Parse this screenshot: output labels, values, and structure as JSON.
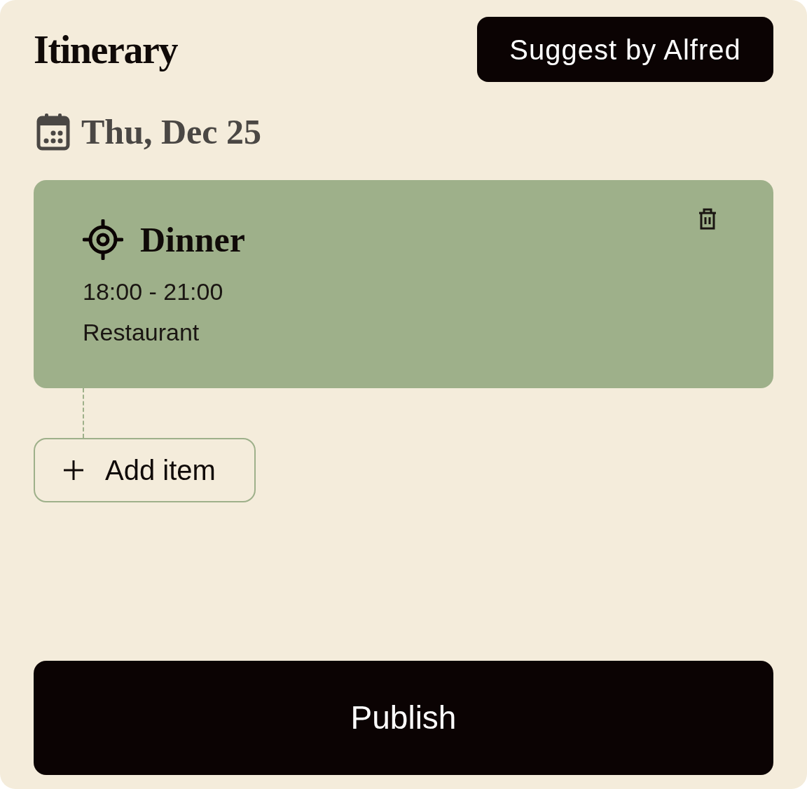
{
  "header": {
    "title": "Itinerary",
    "suggest_button": "Suggest by Alfred"
  },
  "day": {
    "date": "Thu, Dec 25"
  },
  "items": [
    {
      "title": "Dinner",
      "time": "18:00 - 21:00",
      "place": "Restaurant"
    }
  ],
  "add_button": "Add item",
  "publish_button": "Publish"
}
